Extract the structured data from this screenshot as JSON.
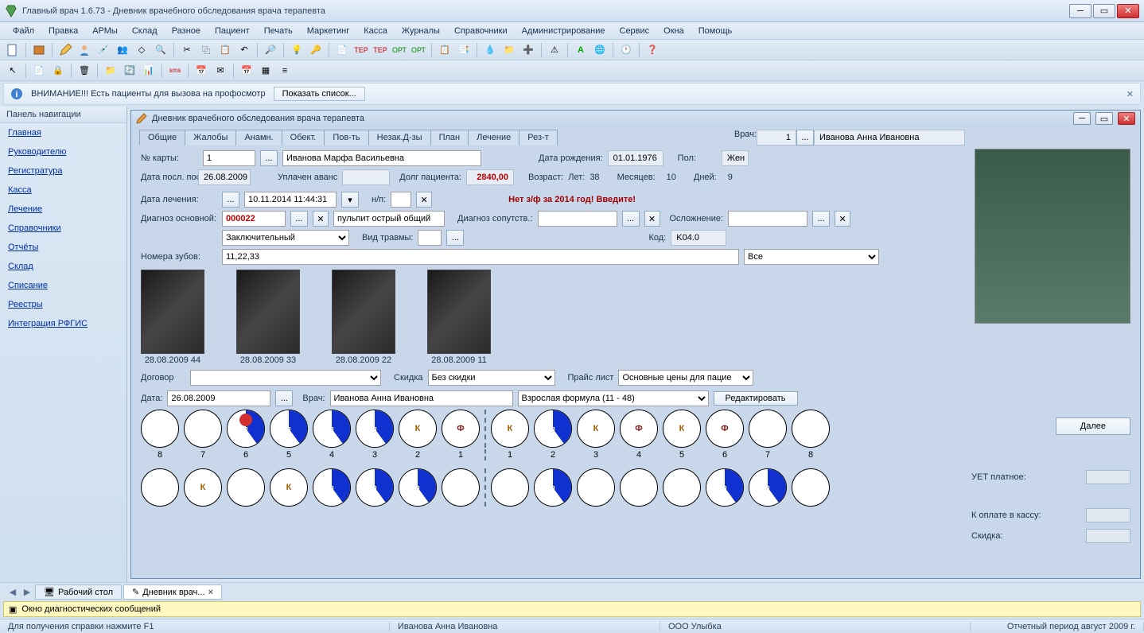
{
  "window": {
    "title": "Главный врач 1.6.73 - Дневник врачебного обследования врача терапевта"
  },
  "menu": [
    "Файл",
    "Правка",
    "АРМы",
    "Склад",
    "Разное",
    "Пациент",
    "Печать",
    "Маркетинг",
    "Касса",
    "Журналы",
    "Справочники",
    "Администрирование",
    "Сервис",
    "Окна",
    "Помощь"
  ],
  "notify": {
    "text": "ВНИМАНИЕ!!! Есть пациенты для вызова на профосмотр",
    "button": "Показать список..."
  },
  "nav": {
    "title": "Панель навигации",
    "links": [
      "Главная",
      "Руководителю",
      "Регистратура",
      "Касса",
      "Лечение",
      "Справочники",
      "Отчёты",
      "Склад",
      "Списание",
      "Реестры",
      "Интеграция РФГИС"
    ]
  },
  "doc": {
    "title": "Дневник врачебного обследования врача терапевта",
    "tabs": [
      "Общие",
      "Жалобы",
      "Анамн.",
      "Обект.",
      "Пов-ть",
      "Незак.Д-зы",
      "План",
      "Лечение",
      "Рез-т"
    ],
    "doctor_label": "Врач:",
    "doctor_num": "1",
    "doctor_name": "Иванова Анна Ивановна",
    "card_label": "№ карты:",
    "card_num": "1",
    "patient_name": "Иванова Марфа Васильевна",
    "dob_label": "Дата рождения:",
    "dob": "01.01.1976",
    "sex_label": "Пол:",
    "sex": "Жен",
    "last_visit_label": "Дата посл. посещ.:",
    "last_visit": "26.08.2009",
    "advance_label": "Уплачен аванс",
    "debt_label": "Долг пациента:",
    "debt": "2840,00",
    "age_label": "Возраст:",
    "years_l": "Лет:",
    "years": "38",
    "months_l": "Месяцев:",
    "months": "10",
    "days_l": "Дней:",
    "days": "9",
    "treat_date_label": "Дата лечения:",
    "treat_date": "10.11.2014 11:44:31",
    "np_label": "н/п:",
    "warn": "Нет з/ф за 2014 год! Введите!",
    "diag_main_label": "Диагноз основной:",
    "diag_code": "000022",
    "diag_text": "пульпит острый общий",
    "diag_comp_label": "Диагноз сопутств.:",
    "compl_label": "Осложнение:",
    "diag_type": "Заключительный",
    "injury_label": "Вид травмы:",
    "code_label": "Код:",
    "code": "K04.0",
    "teeth_nums_label": "Номера зубов:",
    "teeth_nums": "11,22,33",
    "filter_all": "Все",
    "xrays": [
      {
        "cap": "28.08.2009 44"
      },
      {
        "cap": "28.08.2009 33"
      },
      {
        "cap": "28.08.2009 22"
      },
      {
        "cap": "28.08.2009 11"
      }
    ],
    "contract_label": "Договор",
    "discount_label": "Скидка",
    "discount": "Без скидки",
    "price_label": "Прайс лист",
    "price": "Основные цены для пацие",
    "next_btn": "Далее",
    "date2_label": "Дата:",
    "date2": "26.08.2009",
    "doctor2_label": "Врач:",
    "doctor2": "Иванова Анна Ивановна",
    "formula": "Взрослая формула (11 - 48)",
    "edit_btn": "Редактировать",
    "totals": {
      "uet": "УЕТ платное:",
      "topay": "К оплате в кассу:",
      "disc": "Скидка:"
    },
    "teeth_upper_nums": [
      "8",
      "7",
      "6",
      "5",
      "4",
      "3",
      "2",
      "1",
      "1",
      "2",
      "3",
      "4",
      "5",
      "6",
      "7",
      "8"
    ],
    "teeth_upper": [
      {
        "t": ""
      },
      {
        "t": ""
      },
      {
        "t": "п",
        "cls": "blue red-dot"
      },
      {
        "t": "п",
        "cls": "blue"
      },
      {
        "t": "п",
        "cls": "blue"
      },
      {
        "t": "п",
        "cls": "blue"
      },
      {
        "t": "К",
        "cls": "k"
      },
      {
        "t": "Ф",
        "cls": "f"
      },
      {
        "t": "К",
        "cls": "k"
      },
      {
        "t": "п",
        "cls": "blue"
      },
      {
        "t": "К",
        "cls": "k"
      },
      {
        "t": "Ф",
        "cls": "f"
      },
      {
        "t": "К",
        "cls": "k"
      },
      {
        "t": "Ф",
        "cls": "f"
      },
      {
        "t": ""
      },
      {
        "t": ""
      }
    ],
    "teeth_lower": [
      {
        "t": ""
      },
      {
        "t": "К",
        "cls": "k"
      },
      {
        "t": ""
      },
      {
        "t": "К",
        "cls": "k"
      },
      {
        "t": "п",
        "cls": "blue"
      },
      {
        "t": "п",
        "cls": "blue"
      },
      {
        "t": "п",
        "cls": "blue"
      },
      {
        "t": ""
      },
      {
        "t": ""
      },
      {
        "t": "п",
        "cls": "blue"
      },
      {
        "t": ""
      },
      {
        "t": ""
      },
      {
        "t": ""
      },
      {
        "t": "п",
        "cls": "blue"
      },
      {
        "t": "п",
        "cls": "blue"
      },
      {
        "t": ""
      }
    ]
  },
  "bottom_tabs": {
    "t1": "Рабочий стол",
    "t2": "Дневник врач..."
  },
  "diag_bar": "Окно диагностических сообщений",
  "status": {
    "help": "Для получения справки нажмите F1",
    "doctor": "Иванова Анна Ивановна",
    "org": "ООО Улыбка",
    "period": "Отчетный период август 2009 г."
  }
}
